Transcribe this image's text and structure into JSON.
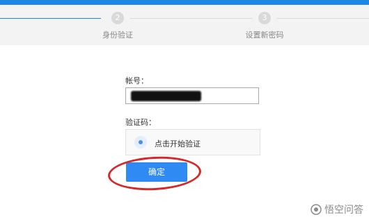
{
  "steps": [
    {
      "number": "2",
      "label": "身份验证"
    },
    {
      "number": "3",
      "label": "设置新密码"
    }
  ],
  "form": {
    "account_label": "帐号：",
    "captcha_label": "验证码：",
    "captcha_prompt": "点击开始验证",
    "confirm_button": "确定"
  },
  "watermark": {
    "text": "悟空问答"
  },
  "colors": {
    "accent": "#1e88e5",
    "button": "#2f8af3",
    "annotation": "#d62828"
  }
}
